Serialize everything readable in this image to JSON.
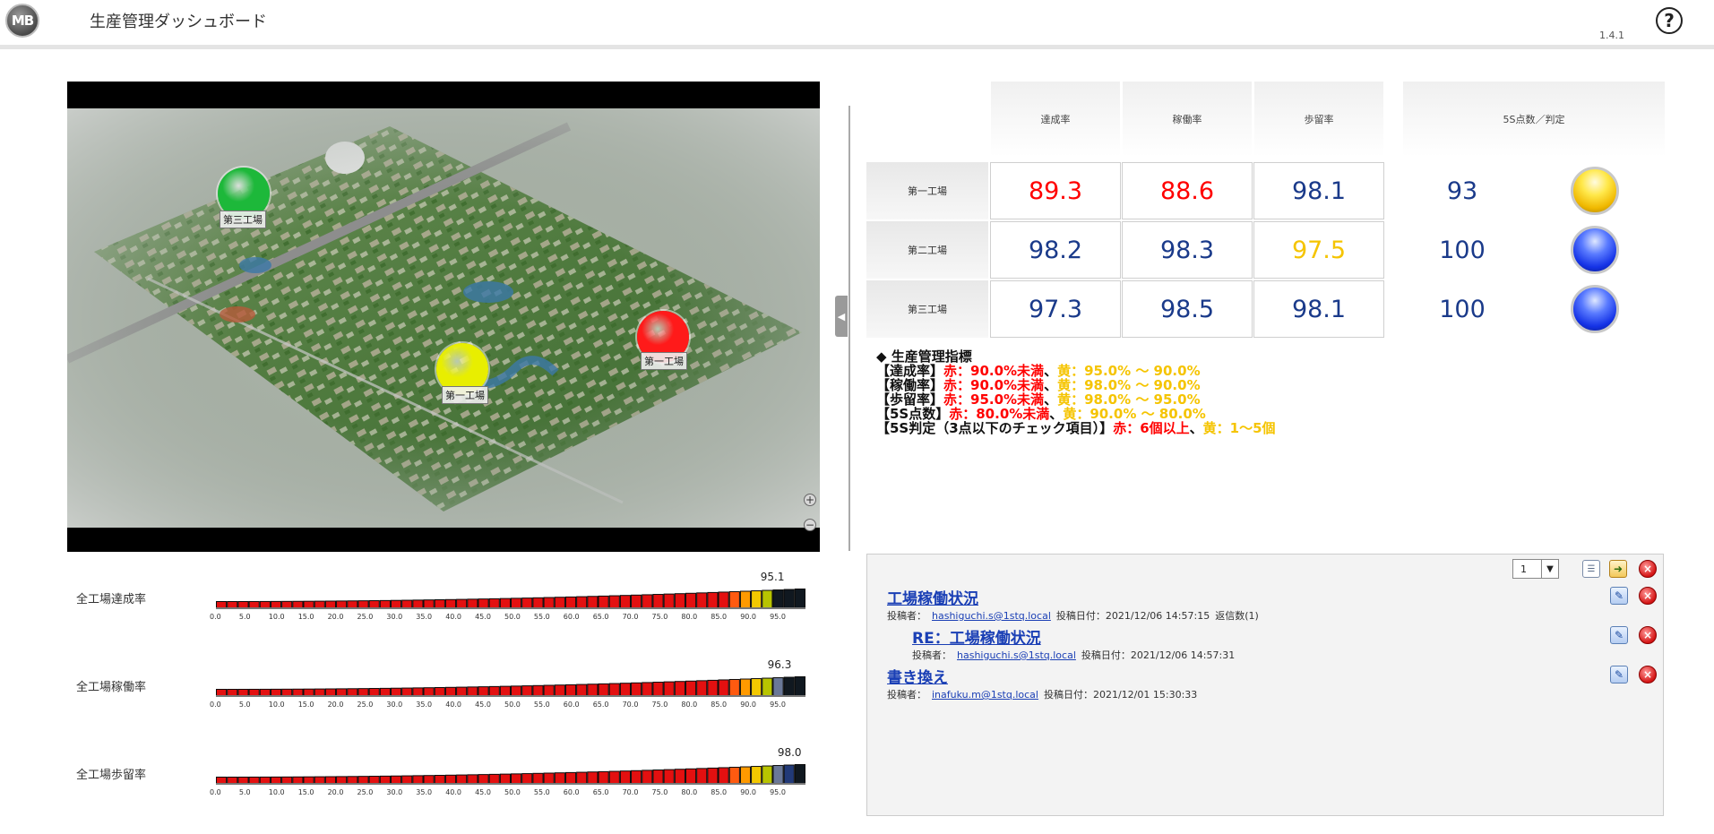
{
  "header": {
    "logo_text": "MB",
    "title": "生産管理ダッシュボード",
    "version": "1.4.1",
    "help_icon": "question-circle-icon",
    "help_label": "?"
  },
  "map": {
    "zoom_in_label": "+",
    "zoom_out_label": "−",
    "splitter_label": "◀",
    "factories": [
      {
        "label": "第三工場",
        "status_color": "#1db83a"
      },
      {
        "label": "第一工場",
        "status_color": "#e8ee00"
      },
      {
        "label": "第一工場",
        "status_color": "#ff1a1a"
      }
    ]
  },
  "kpi_table": {
    "headers": [
      "達成率",
      "稼働率",
      "歩留率",
      "5S点数／判定"
    ],
    "rows": [
      {
        "name": "第一工場",
        "values": [
          {
            "v": "89.3",
            "color": "#ff0000"
          },
          {
            "v": "88.6",
            "color": "#ff0000"
          },
          {
            "v": "98.1",
            "color": "#1a3a8a"
          }
        ],
        "score": "93",
        "judgement": "yellow"
      },
      {
        "name": "第二工場",
        "values": [
          {
            "v": "98.2",
            "color": "#1a3a8a"
          },
          {
            "v": "98.3",
            "color": "#1a3a8a"
          },
          {
            "v": "97.5",
            "color": "#f5c400"
          }
        ],
        "score": "100",
        "judgement": "blue"
      },
      {
        "name": "第三工場",
        "values": [
          {
            "v": "97.3",
            "color": "#1a3a8a"
          },
          {
            "v": "98.5",
            "color": "#1a3a8a"
          },
          {
            "v": "98.1",
            "color": "#1a3a8a"
          }
        ],
        "score": "100",
        "judgement": "blue"
      }
    ]
  },
  "legend": {
    "title": "◆ 生産管理指標",
    "lines": [
      {
        "label": "【達成率】",
        "red": "赤：90.0%未満",
        "sep": "、",
        "yellow": "黄：95.0% 〜 90.0%"
      },
      {
        "label": "【稼働率】",
        "red": "赤：90.0%未満",
        "sep": "、",
        "yellow": "黄：98.0% 〜 90.0%"
      },
      {
        "label": "【歩留率】",
        "red": "赤：95.0%未満",
        "sep": "、",
        "yellow": "黄：98.0% 〜 95.0%"
      },
      {
        "label": "【5S点数】",
        "red": "赤：80.0%未満",
        "sep": "、",
        "yellow": "黄：90.0% 〜 80.0%"
      },
      {
        "label": "【5S判定（3点以下のチェック項目）】",
        "red": "赤：6個以上",
        "sep": "、",
        "yellow": "黄：1〜5個"
      }
    ]
  },
  "gauges": {
    "ticks": [
      "0.0",
      "5.0",
      "10.0",
      "15.0",
      "20.0",
      "25.0",
      "30.0",
      "35.0",
      "40.0",
      "45.0",
      "50.0",
      "55.0",
      "60.0",
      "65.0",
      "70.0",
      "75.0",
      "80.0",
      "85.0",
      "90.0",
      "95.0"
    ],
    "items": [
      {
        "label": "全工場達成率",
        "value": 95.1,
        "value_text": "95.1"
      },
      {
        "label": "全工場稼働率",
        "value": 96.3,
        "value_text": "96.3"
      },
      {
        "label": "全工場歩留率",
        "value": 98.0,
        "value_text": "98.0"
      }
    ]
  },
  "messages": {
    "page": "1",
    "posts": [
      {
        "title": "工場稼働状況",
        "poster_label": "投稿者：",
        "poster": "hashiguchi.s@1stq.local",
        "date": "投稿日付：2021/12/06 14:57:15",
        "replies": "返信数(1)"
      },
      {
        "title": "RE：工場稼働状況",
        "poster_label": "投稿者：",
        "poster": "hashiguchi.s@1stq.local",
        "date": "投稿日付：2021/12/06 14:57:31",
        "replies": ""
      },
      {
        "title": "書き換え",
        "poster_label": "投稿者：",
        "poster": "inafuku.m@1stq.local",
        "date": "投稿日付：2021/12/01 15:30:33",
        "replies": ""
      }
    ]
  }
}
